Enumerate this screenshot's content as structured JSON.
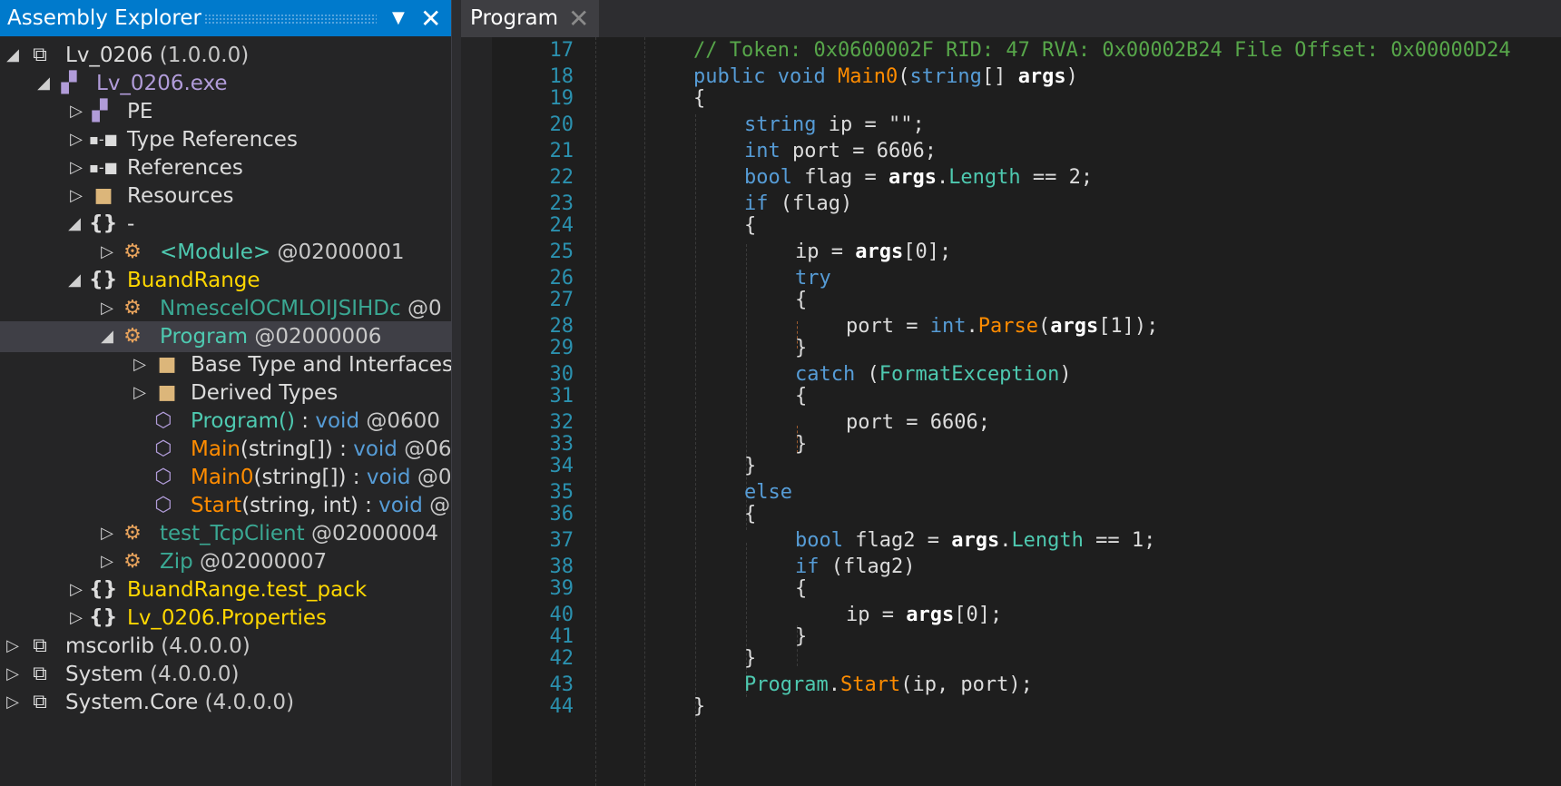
{
  "explorer": {
    "title": "Assembly Explorer",
    "rows": [
      {
        "label": "Lv_0206",
        "suffix": " (1.0.0.0)",
        "icon": "assembly-icon"
      },
      {
        "label": "Lv_0206.exe",
        "icon": "module-icon"
      },
      {
        "label": "PE",
        "icon": "pe-icon"
      },
      {
        "label": "Type References",
        "icon": "type-references-icon"
      },
      {
        "label": "References",
        "icon": "references-icon"
      },
      {
        "label": "Resources",
        "icon": "folder-icon"
      },
      {
        "label": "-",
        "icon": "namespace-icon"
      },
      {
        "label": "<Module>",
        "suffix": " @02000001",
        "icon": "class-icon"
      },
      {
        "label": "BuandRange",
        "icon": "namespace-icon"
      },
      {
        "label": "NmescelOCMLOIJSIHDc",
        "suffix": " @0",
        "icon": "class-icon"
      },
      {
        "label": "Program",
        "suffix": " @02000006",
        "icon": "class-icon"
      },
      {
        "label": "Base Type and Interfaces",
        "icon": "folder-icon"
      },
      {
        "label": "Derived Types",
        "icon": "folder-icon"
      },
      {
        "label": "Program()",
        "sep": " : ",
        "ret": "void",
        "suffix": " @0600",
        "icon": "method-icon"
      },
      {
        "label": "Main",
        "args": "(string[])",
        "sep": " : ",
        "ret": "void",
        "suffix": " @06",
        "icon": "method-icon"
      },
      {
        "label": "Main0",
        "args": "(string[])",
        "sep": " : ",
        "ret": "void",
        "suffix": " @0",
        "icon": "method-icon"
      },
      {
        "label": "Start",
        "args": "(string, int)",
        "sep": " : ",
        "ret": "void",
        "suffix": " @",
        "icon": "method-icon"
      },
      {
        "label": "test_TcpClient",
        "suffix": " @02000004",
        "icon": "class-icon"
      },
      {
        "label": "Zip",
        "suffix": " @02000007",
        "icon": "class-icon"
      },
      {
        "label": "BuandRange.test_pack",
        "icon": "namespace-icon"
      },
      {
        "label": "Lv_0206.Properties",
        "icon": "namespace-icon"
      },
      {
        "label": "mscorlib",
        "suffix": " (4.0.0.0)",
        "icon": "assembly-icon"
      },
      {
        "label": "System",
        "suffix": " (4.0.0.0)",
        "icon": "assembly-icon"
      },
      {
        "label": "System.Core",
        "suffix": " (4.0.0.0)",
        "icon": "assembly-icon"
      }
    ]
  },
  "editor": {
    "tab_label": "Program",
    "line_numbers": [
      "17",
      "18",
      "19",
      "20",
      "21",
      "22",
      "23",
      "24",
      "25",
      "26",
      "27",
      "28",
      "29",
      "30",
      "31",
      "32",
      "33",
      "34",
      "35",
      "36",
      "37",
      "38",
      "39",
      "40",
      "41",
      "42",
      "43",
      "44"
    ],
    "code": {
      "l17": "// Token: 0x0600002F RID: 47 RVA: 0x00002B24 File Offset: 0x00000D24",
      "l18": [
        "public",
        "void",
        "Main0",
        "(",
        "string",
        "[] ",
        "args",
        ")"
      ],
      "l19": "{",
      "l20": [
        "string",
        " ip = \"\";"
      ],
      "l21": [
        "int",
        " port = 6606;"
      ],
      "l22": [
        "bool",
        " flag = ",
        "args",
        ".",
        "Length",
        " == 2;"
      ],
      "l23": [
        "if",
        " (flag)"
      ],
      "l24": "{",
      "l25": [
        "ip = ",
        "args",
        "[0];"
      ],
      "l26": "try",
      "l27": "{",
      "l28": [
        "port = ",
        "int",
        ".",
        "Parse",
        "(",
        "args",
        "[1]);"
      ],
      "l29": "}",
      "l30": [
        "catch",
        " (",
        "FormatException",
        ")"
      ],
      "l31": "{",
      "l32": "port = 6606;",
      "l33": "}",
      "l34": "}",
      "l35": "else",
      "l36": "{",
      "l37": [
        "bool",
        " flag2 = ",
        "args",
        ".",
        "Length",
        " == 1;"
      ],
      "l38": [
        "if",
        " (flag2)"
      ],
      "l39": "{",
      "l40": [
        "ip = ",
        "args",
        "[0];"
      ],
      "l41": "}",
      "l42": "}",
      "l43": [
        "Program",
        ".",
        "Start",
        "(ip, port);"
      ],
      "l44": "}"
    }
  },
  "colors": {
    "accent": "#007acc",
    "keyword": "#569cd6",
    "type": "#4ec9b0",
    "method": "#ff8c00",
    "comment": "#57a64a",
    "line_number": "#2b91af",
    "namespace": "#ffd700"
  }
}
